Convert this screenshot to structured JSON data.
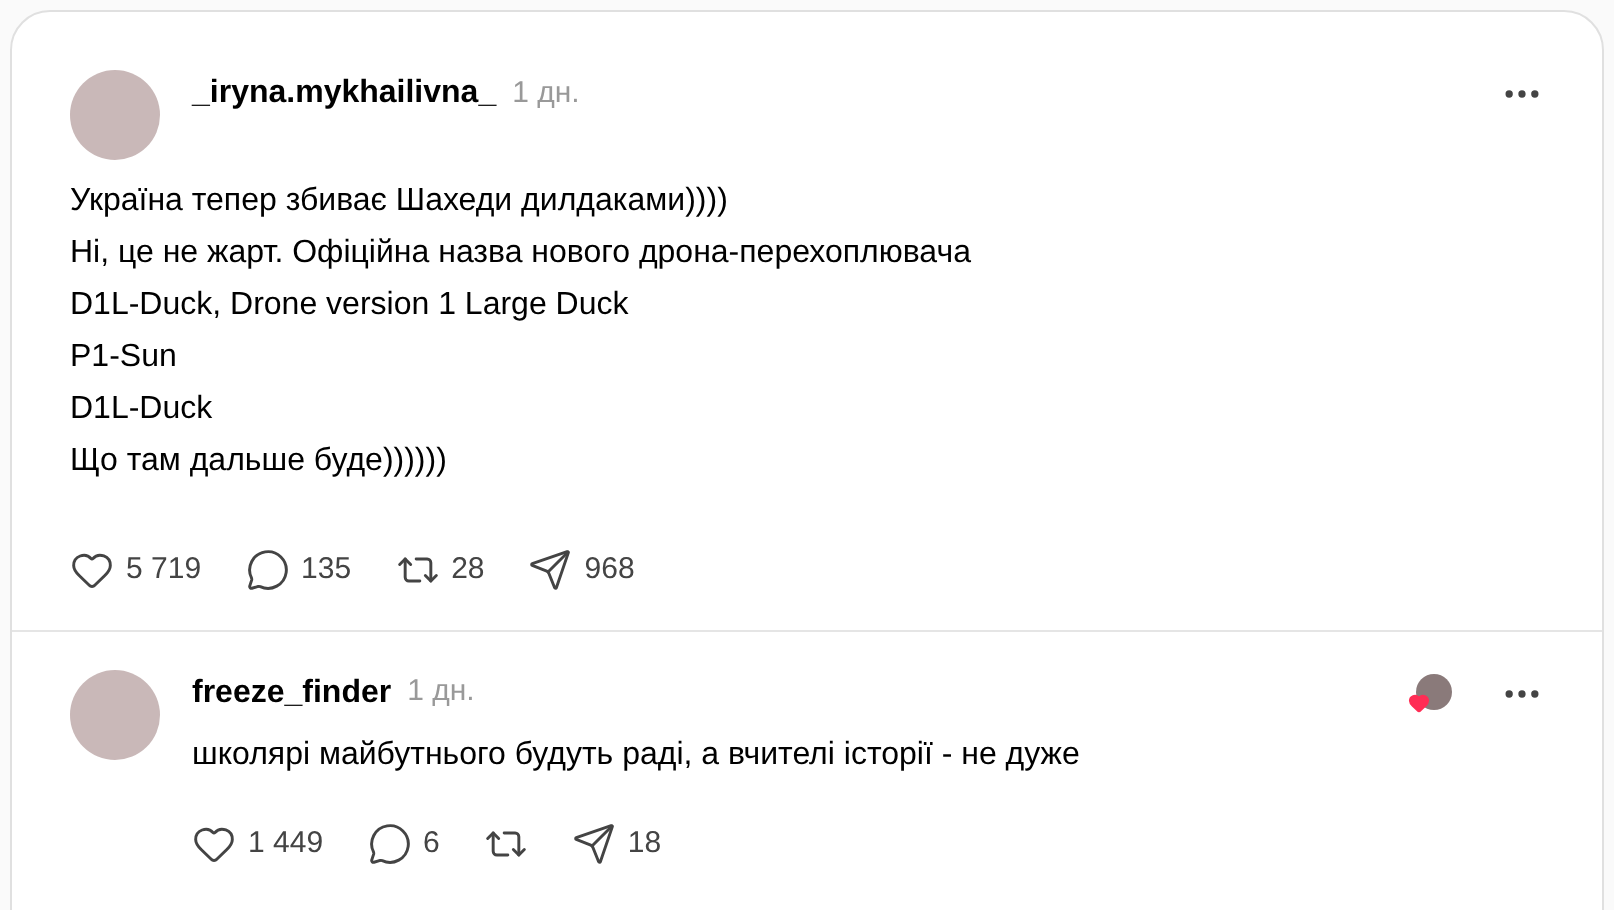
{
  "posts": [
    {
      "author": "_iryna.mykhailivna_",
      "time": "1 дн.",
      "liked_by_author": false,
      "lines": [
        "Україна тепер збиває Шахеди дилдаками))))",
        "Ні, це не жарт. Офіційна назва нового дрона-перехоплювача",
        "D1L-Duck, Drone version 1 Large Duck",
        "P1-Sun",
        "D1L-Duck",
        "Що там дальше буде))))))"
      ],
      "actions": [
        {
          "kind": "like",
          "count": "5 719"
        },
        {
          "kind": "reply",
          "count": "135"
        },
        {
          "kind": "repost",
          "count": "28"
        },
        {
          "kind": "share",
          "count": "968"
        }
      ]
    },
    {
      "author": "freeze_finder",
      "time": "1 дн.",
      "liked_by_author": true,
      "lines": [
        "школярі майбутнього будуть раді, а вчителі історії - не дуже"
      ],
      "actions": [
        {
          "kind": "like",
          "count": "1 449"
        },
        {
          "kind": "reply",
          "count": "6"
        },
        {
          "kind": "repost"
        },
        {
          "kind": "share",
          "count": "18"
        }
      ]
    }
  ]
}
